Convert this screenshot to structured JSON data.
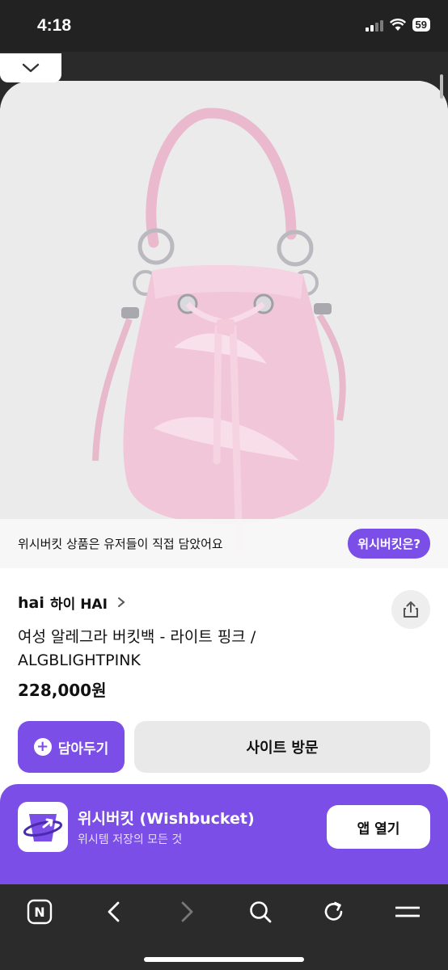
{
  "status_bar": {
    "time": "4:18",
    "battery": "59"
  },
  "notice": {
    "text": "위시버킷 상품은 유저들이 직접 담았어요",
    "button_label": "위시버킷은?"
  },
  "brand": {
    "logo_text": "hai",
    "name": "하이 HAI"
  },
  "product": {
    "title": "여성 알레그라 버킷백 - 라이트 핑크 / ALGBLIGHTPINK",
    "price": "228,000원",
    "image_alt": "pink bucket bag"
  },
  "actions": {
    "save_label": "담아두기",
    "visit_label": "사이트 방문"
  },
  "app_banner": {
    "name": "위시버킷 (Wishbucket)",
    "subtitle": "위시템 저장의 모든 것",
    "open_label": "앱 열기"
  },
  "browser_bar": {
    "home_icon_letter": "N"
  },
  "colors": {
    "accent": "#7b4ee8",
    "image_bg": "#ebebeb",
    "bag_pink": "#f1c6d8"
  }
}
